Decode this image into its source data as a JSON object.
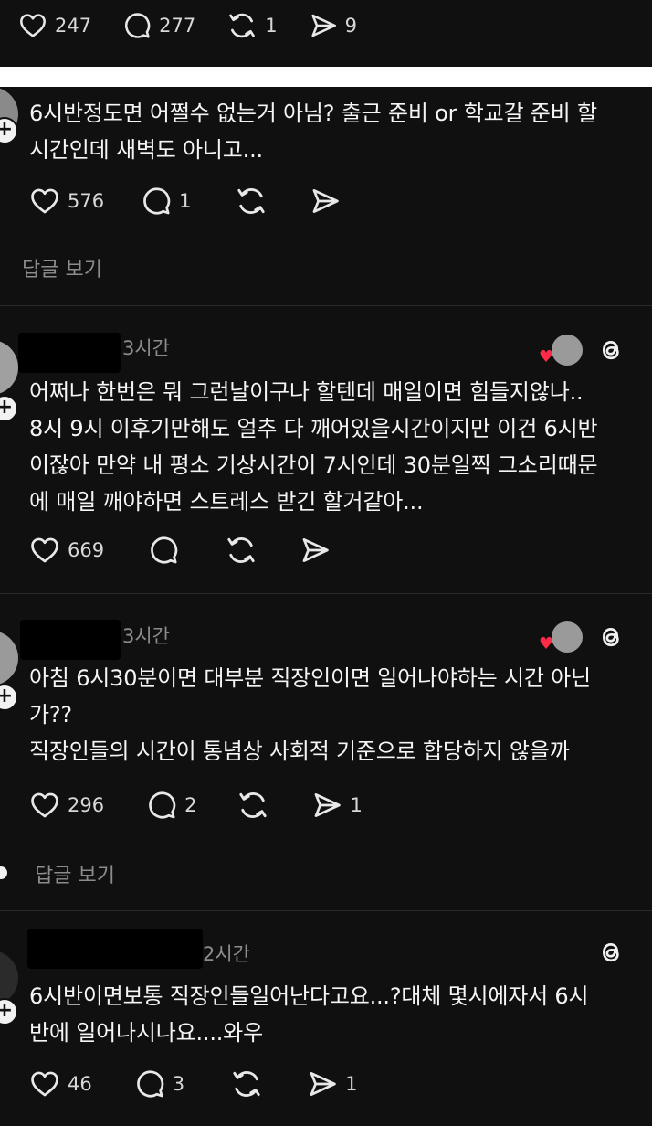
{
  "top_post": {
    "likes": "247",
    "comments": "277",
    "reposts": "1",
    "shares": "9"
  },
  "comments": [
    {
      "time": "",
      "lines": [
        "6시반정도면 어쩔수 없는거 아님? 출근 준비 or 학교갈 준비 할",
        "시간인데 새벽도 아니고..."
      ],
      "likes": "576",
      "replies": "1",
      "reposts": "",
      "shares": "",
      "view_replies": "답글 보기"
    },
    {
      "time": "3시간",
      "lines": [
        "어쩌나 한번은 뭐 그런날이구나 할텐데 매일이면 힘들지않나..",
        "8시 9시 이후기만해도 얼추 다 깨어있을시간이지만 이건 6시반",
        "이잖아 만약 내 평소 기상시간이 7시인데 30분일찍 그소리때문",
        "에 매일 깨야하면 스트레스 받긴 할거같아..."
      ],
      "likes": "669",
      "replies": "",
      "reposts": "",
      "shares": ""
    },
    {
      "time": "3시간",
      "lines": [
        "아침 6시30분이면 대부분 직장인이면 일어나야하는 시간 아닌",
        "가??",
        "직장인들의 시간이 통념상 사회적 기준으로 합당하지 않을까"
      ],
      "likes": "296",
      "replies": "2",
      "reposts": "",
      "shares": "1",
      "view_replies": "답글 보기"
    },
    {
      "time": "2시간",
      "lines": [
        "6시반이면보통 직장인들일어난다고요...?대체 몇시에자서 6시",
        "반에 일어나시나요....와우"
      ],
      "likes": "46",
      "replies": "3",
      "reposts": "",
      "shares": "1"
    }
  ],
  "icons": {
    "like": "heart-icon",
    "reply": "comment-bubble-icon",
    "repost": "repost-icon",
    "share": "send-icon",
    "app": "threads-icon"
  }
}
